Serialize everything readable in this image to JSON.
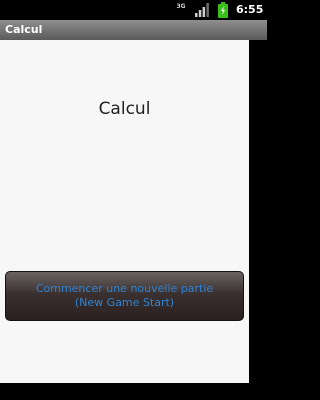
{
  "status_bar": {
    "network_label": "3G",
    "time": "6:55",
    "icons": [
      "3g-icon",
      "signal-icon",
      "battery-charging-icon"
    ],
    "battery_color": "#39c019"
  },
  "app": {
    "title": "Calcul"
  },
  "main": {
    "heading": "Calcul",
    "new_game_button": {
      "line1": "Commencer une nouvelle partie",
      "line2": "(New Game Start)"
    }
  },
  "colors": {
    "button_text": "#2f84d3",
    "content_background": "#f7f7f7",
    "title_bar": "#7a7a7a"
  }
}
